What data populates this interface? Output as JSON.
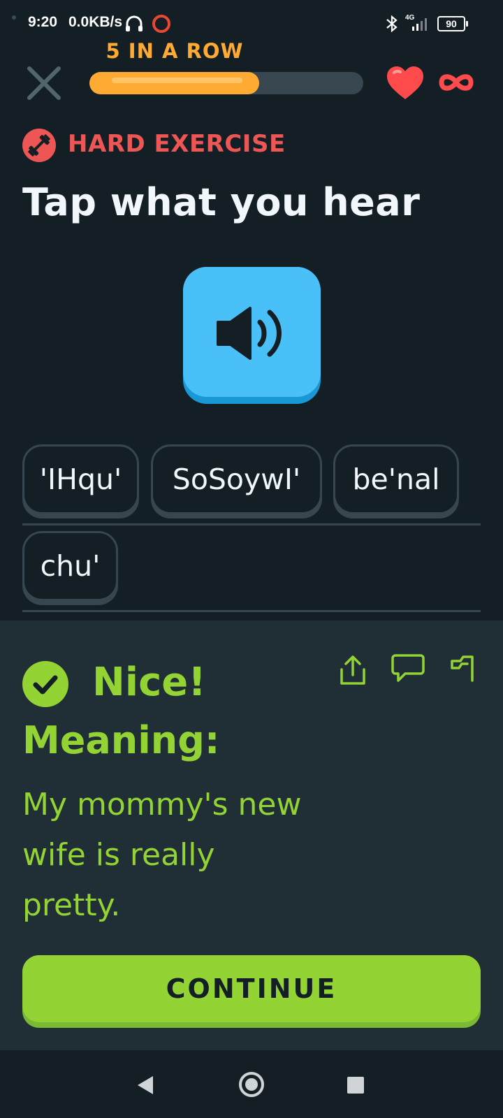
{
  "status_bar": {
    "time": "9:20",
    "speed": "0.0KB/s",
    "network": "4G",
    "battery": "90"
  },
  "header": {
    "streak_label": "5 IN A ROW",
    "progress": 0.62,
    "hearts": "∞"
  },
  "exercise": {
    "difficulty_label": "HARD EXERCISE",
    "prompt": "Tap what you hear"
  },
  "word_bank": {
    "words": [
      "'IHqu'",
      "SoSoywI'",
      "be'nal",
      "chu'"
    ]
  },
  "feedback": {
    "result": "Nice!",
    "meaning_label": "Meaning:",
    "translation": "My mommy's new wife is really pretty.",
    "continue_label": "CONTINUE"
  },
  "colors": {
    "background": "#131f24",
    "accent_orange": "#ffab33",
    "hard_red": "#ee5555",
    "speaker_blue": "#49c0f8",
    "success_green": "#93d333",
    "panel": "#202f36"
  }
}
